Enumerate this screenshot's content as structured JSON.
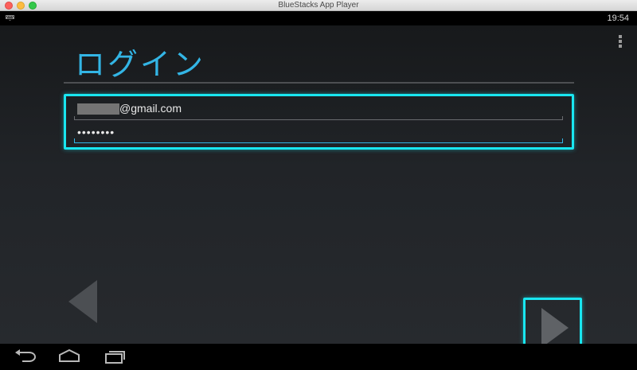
{
  "window": {
    "title": "BlueStacks App Player"
  },
  "status_bar": {
    "time": "19:54",
    "notification_icon": "keyboard-icon"
  },
  "screen": {
    "title": "ログイン",
    "email": {
      "visible_suffix": "@gmail.com",
      "redacted": true
    },
    "password": {
      "masked_value": "••••••••"
    },
    "overflow_menu_icon": "vertical-dots-icon",
    "prev_icon": "left-triangle-icon",
    "next_icon": "right-triangle-icon"
  },
  "nav_bar": {
    "icons": [
      "back-icon",
      "home-icon",
      "recent-apps-icon"
    ]
  },
  "colors": {
    "accent": "#33b5e5",
    "highlight": "#19e6f0",
    "background_top": "#17191b",
    "background_bottom": "#272a2e"
  }
}
